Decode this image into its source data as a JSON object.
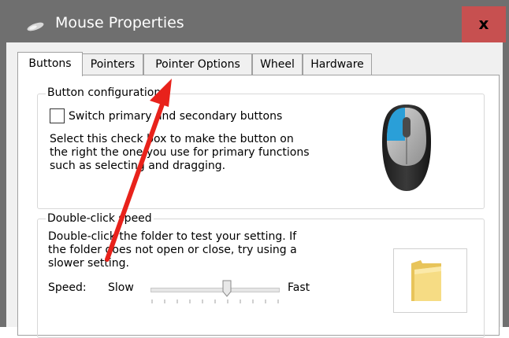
{
  "window": {
    "title": "Mouse Properties",
    "close_label": "x",
    "title_icon": "mouse-icon"
  },
  "tabs": [
    {
      "label": "Buttons",
      "active": true
    },
    {
      "label": "Pointers",
      "active": false
    },
    {
      "label": "Pointer Options",
      "active": false
    },
    {
      "label": "Wheel",
      "active": false
    },
    {
      "label": "Hardware",
      "active": false
    }
  ],
  "button_config": {
    "legend": "Button configuration",
    "checkbox_label": "Switch primary and secondary buttons",
    "checkbox_checked": false,
    "description": [
      "Select this check box to make the button on",
      "the right the one you use for primary functions",
      "such as selecting and dragging."
    ],
    "image_icon": "mouse-icon"
  },
  "double_click": {
    "legend": "Double-click speed",
    "description": [
      "Double-click the folder to test your setting. If",
      "the folder does not open or close, try using a",
      "slower setting."
    ],
    "speed_label": "Speed:",
    "slow_label": "Slow",
    "fast_label": "Fast",
    "speed_value": 0.6,
    "folder_icon": "folder-icon"
  },
  "annotation": {
    "icon": "red-arrow-icon",
    "color": "#e8221b"
  }
}
